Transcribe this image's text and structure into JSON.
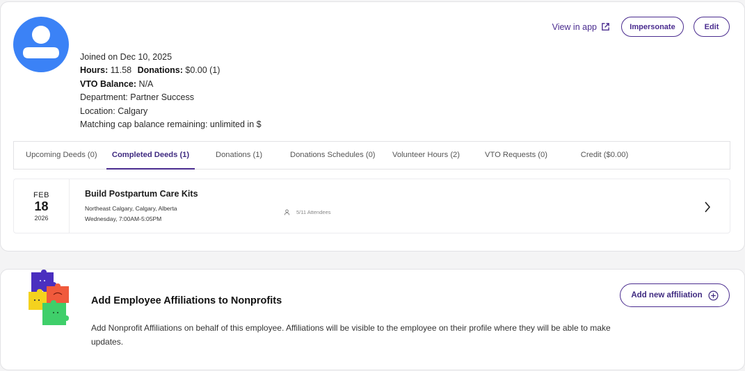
{
  "profile": {
    "joined": "Joined on Dec 10, 2025",
    "hours_label": "Hours:",
    "hours_value": "11.58",
    "donations_label": "Donations:",
    "donations_value": "$0.00 (1)",
    "vto_label": "VTO Balance:",
    "vto_value": "N/A",
    "department": "Department: Partner Success",
    "location": "Location: Calgary",
    "matching": "Matching cap balance remaining: unlimited in $"
  },
  "actions": {
    "view_in_app": "View in app",
    "impersonate": "Impersonate",
    "edit": "Edit"
  },
  "tabs": [
    {
      "label": "Upcoming Deeds (0)"
    },
    {
      "label": "Completed Deeds (1)"
    },
    {
      "label": "Donations (1)"
    },
    {
      "label": "Donations Schedules (0)"
    },
    {
      "label": "Volunteer Hours (2)"
    },
    {
      "label": "VTO Requests (0)"
    },
    {
      "label": "Credit ($0.00)"
    }
  ],
  "active_tab": 1,
  "deed": {
    "month": "FEB",
    "day": "18",
    "year": "2026",
    "title": "Build Postpartum Care Kits",
    "location": "Northeast Calgary, Calgary, Alberta",
    "time": "Wednesday, 7:00AM-5:05PM",
    "attendees": "5/11 Attendees"
  },
  "affiliations": {
    "title": "Add Employee Affiliations to Nonprofits",
    "description": "Add Nonprofit Affiliations on behalf of this employee. Affiliations will be visible to the employee on their profile where they will be able to make updates.",
    "button": "Add new affiliation"
  },
  "icons": {
    "avatar": "user-avatar-icon",
    "external_link": "external-link-icon",
    "attendees": "person-icon",
    "chevron": "chevron-right-icon",
    "add": "plus-circle-icon",
    "puzzle": "puzzle-pieces-icon"
  },
  "colors": {
    "accent": "#4a2c8f",
    "avatar": "#3b82f6",
    "background": "#f4f4f5"
  }
}
